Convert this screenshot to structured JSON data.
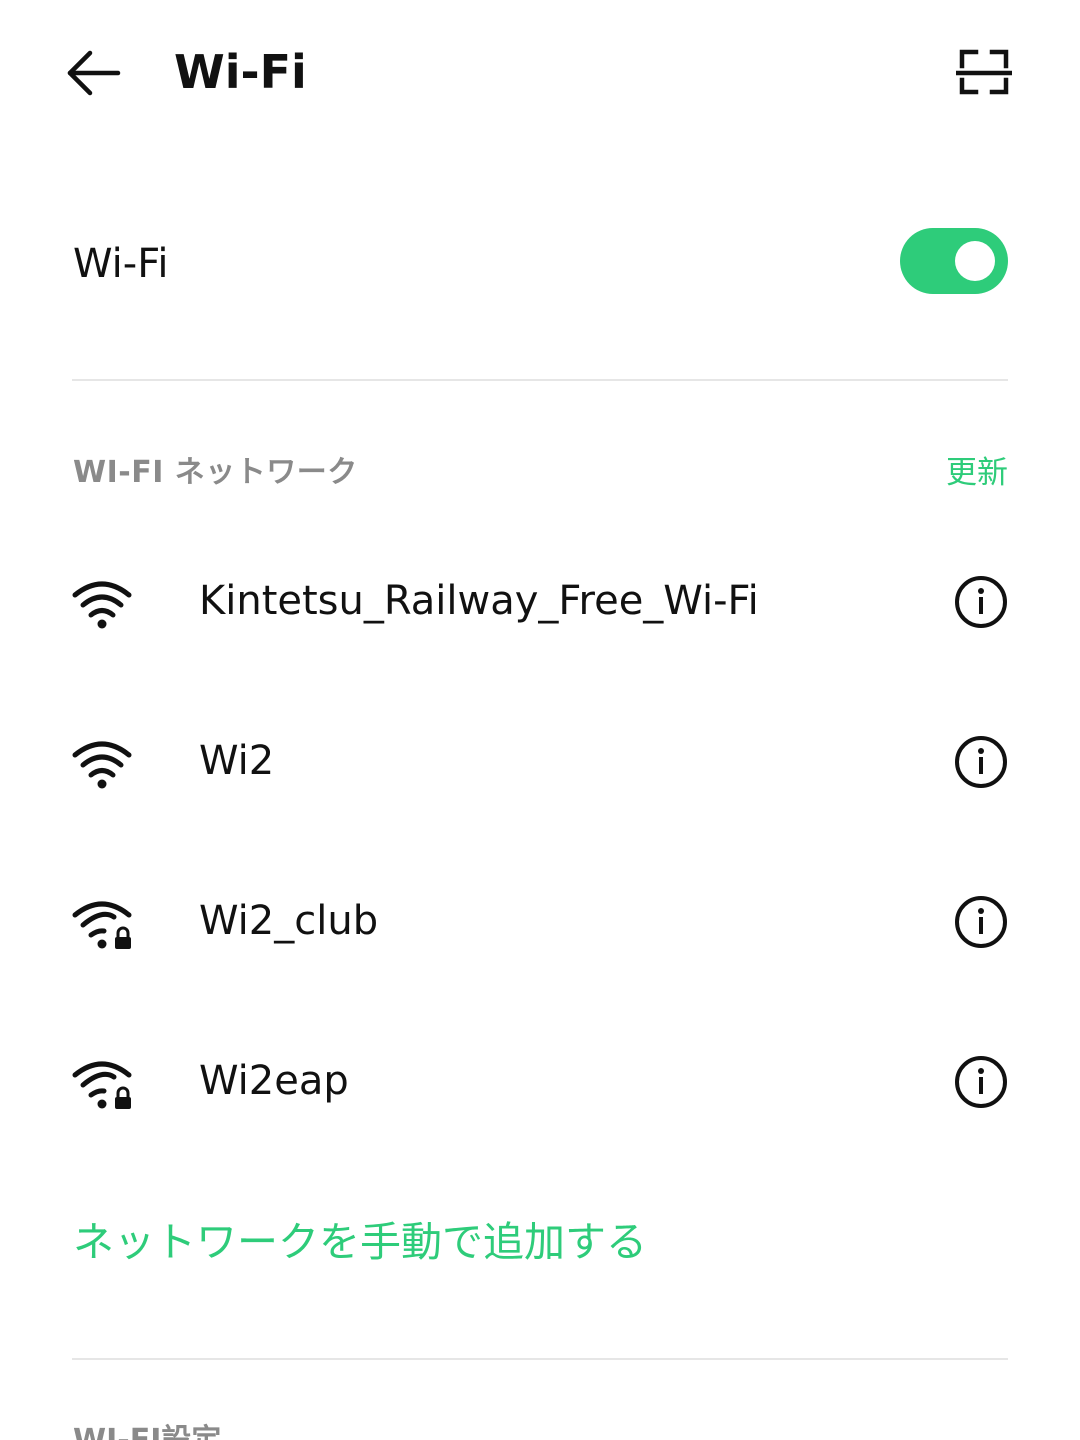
{
  "header": {
    "title": "Wi-Fi",
    "back_icon": "arrow-left-icon",
    "scan_icon": "qr-scan-icon"
  },
  "wifi_toggle": {
    "label": "Wi-Fi",
    "state": "on",
    "color": "#2ecc7a"
  },
  "networks_section": {
    "title": "WI-FI ネットワーク",
    "refresh_label": "更新",
    "networks": [
      {
        "ssid": "Kintetsu_Railway_Free_Wi-Fi",
        "secured": false,
        "icon": "wifi-signal-icon"
      },
      {
        "ssid": "Wi2",
        "secured": false,
        "icon": "wifi-signal-icon"
      },
      {
        "ssid": "Wi2_club",
        "secured": true,
        "icon": "wifi-signal-locked-icon"
      },
      {
        "ssid": "Wi2eap",
        "secured": true,
        "icon": "wifi-signal-locked-icon"
      }
    ],
    "add_network_label": "ネットワークを手動で追加する"
  },
  "settings_section": {
    "title": "WI-FI設定"
  },
  "colors": {
    "accent": "#2ecc7a",
    "section_gray": "#8a8a8a",
    "divider": "#e6e6e6"
  }
}
